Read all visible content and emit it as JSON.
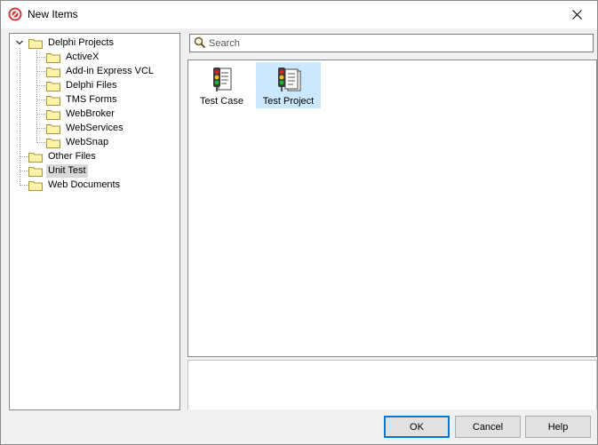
{
  "window": {
    "title": "New Items"
  },
  "tree": {
    "items": [
      {
        "label": "Delphi Projects",
        "level": 0,
        "expanded": true
      },
      {
        "label": "ActiveX",
        "level": 1
      },
      {
        "label": "Add-in Express VCL",
        "level": 1
      },
      {
        "label": "Delphi Files",
        "level": 1
      },
      {
        "label": "TMS Forms",
        "level": 1
      },
      {
        "label": "WebBroker",
        "level": 1
      },
      {
        "label": "WebServices",
        "level": 1
      },
      {
        "label": "WebSnap",
        "level": 1
      },
      {
        "label": "Other Files",
        "level": 0
      },
      {
        "label": "Unit Test",
        "level": 0,
        "selected": true
      },
      {
        "label": "Web Documents",
        "level": 0
      }
    ]
  },
  "search": {
    "placeholder": "Search",
    "value": ""
  },
  "items": [
    {
      "label": "Test Case",
      "icon": "test-case-icon",
      "selected": false
    },
    {
      "label": "Test Project",
      "icon": "test-project-icon",
      "selected": true
    }
  ],
  "buttons": {
    "ok": "OK",
    "cancel": "Cancel",
    "help": "Help"
  },
  "colors": {
    "selection": "#cce8ff",
    "tree_selection": "#d9d9d9",
    "default_button_border": "#0078d7"
  }
}
